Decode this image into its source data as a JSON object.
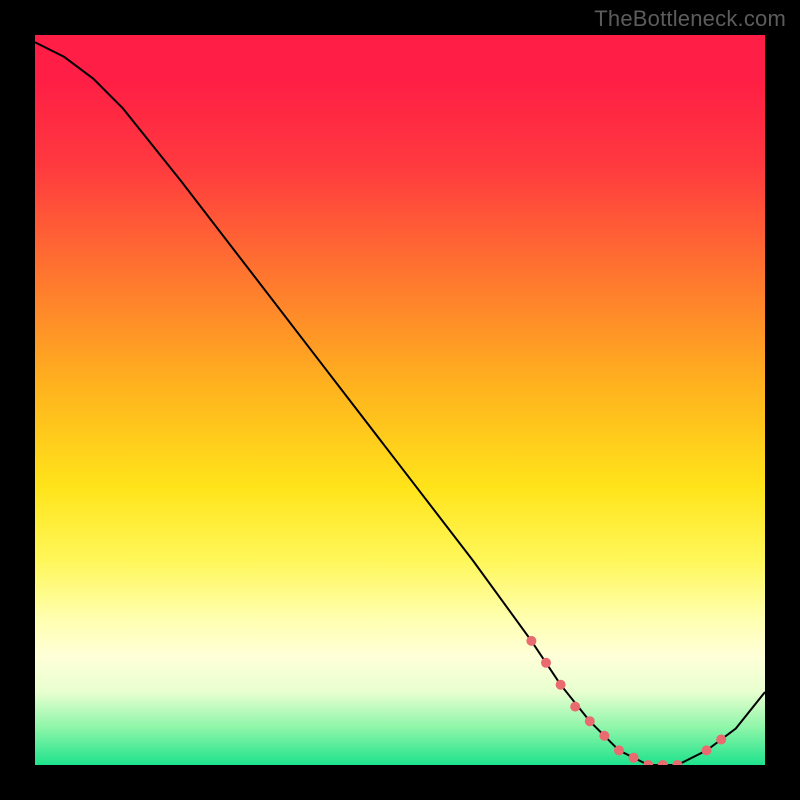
{
  "watermark": "TheBottleneck.com",
  "colors": {
    "curve": "#000000",
    "marker": "#e96a6f",
    "gradient_top": "#ff1e45",
    "gradient_bottom": "#1de28c",
    "frame": "#000000"
  },
  "chart_data": {
    "type": "line",
    "title": "",
    "xlabel": "",
    "ylabel": "",
    "xlim": [
      0,
      100
    ],
    "ylim": [
      0,
      100
    ],
    "series": [
      {
        "name": "bottleneck-curve",
        "x": [
          0,
          4,
          8,
          12,
          20,
          30,
          40,
          50,
          60,
          68,
          72,
          76,
          80,
          84,
          88,
          92,
          96,
          100
        ],
        "y": [
          99,
          97,
          94,
          90,
          80,
          67,
          54,
          41,
          28,
          17,
          11,
          6,
          2,
          0,
          0,
          2,
          5,
          10
        ]
      }
    ],
    "markers": {
      "name": "highlight-dots",
      "color": "#e96a6f",
      "radius": 5,
      "x": [
        68,
        70,
        72,
        74,
        76,
        78,
        80,
        82,
        84,
        86,
        88,
        92,
        94
      ],
      "y": [
        17,
        14,
        11,
        8,
        6,
        4,
        2,
        1,
        0,
        0,
        0,
        2,
        3.5
      ]
    }
  }
}
